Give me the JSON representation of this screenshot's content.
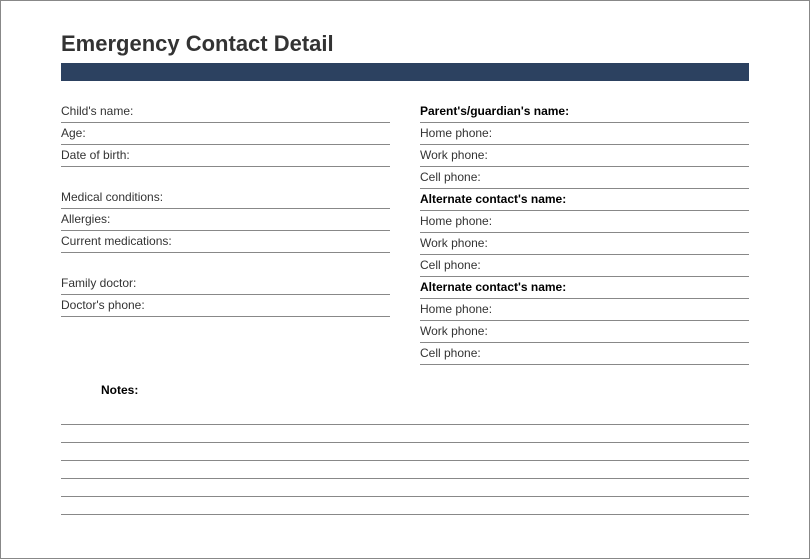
{
  "title": "Emergency Contact Detail",
  "left": {
    "child_name": "Child's name:",
    "age": "Age:",
    "dob": "Date of birth:",
    "medical_conditions": "Medical conditions:",
    "allergies": "Allergies:",
    "current_medications": "Current medications:",
    "family_doctor": "Family doctor:",
    "doctor_phone": "Doctor's phone:"
  },
  "right": {
    "parent_name": "Parent's/guardian's name:",
    "home_phone1": "Home phone:",
    "work_phone1": "Work phone:",
    "cell_phone1": "Cell phone:",
    "alt1_name": "Alternate contact's name:",
    "home_phone2": "Home phone:",
    "work_phone2": "Work phone:",
    "cell_phone2": "Cell phone:",
    "alt2_name": "Alternate contact's name:",
    "home_phone3": "Home phone:",
    "work_phone3": "Work phone:",
    "cell_phone3": "Cell phone:"
  },
  "notes_label": "Notes:"
}
